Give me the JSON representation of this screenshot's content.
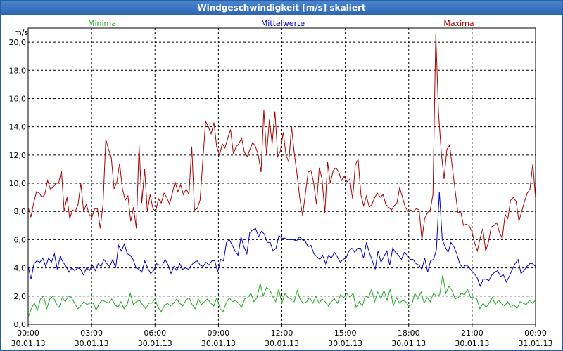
{
  "window": {
    "title": "Windgeschwindigkeit [m/s] skaliert"
  },
  "chart_data": {
    "type": "line",
    "title": "Windgeschwindigkeit [m/s] skaliert",
    "ylabel": "m/s",
    "ylim": [
      0,
      21
    ],
    "y_ticks": [
      "0,0",
      "2,0",
      "4,0",
      "6,0",
      "8,0",
      "10,0",
      "12,0",
      "14,0",
      "16,0",
      "18,0",
      "20,0"
    ],
    "x_start": "30.01.13 00:00",
    "x_end": "31.01.13 00:00",
    "x_ticks": [
      {
        "time": "00:00",
        "date": "30.01.13"
      },
      {
        "time": "03:00",
        "date": "30.01.13"
      },
      {
        "time": "06:00",
        "date": "30.01.13"
      },
      {
        "time": "09:00",
        "date": "30.01.13"
      },
      {
        "time": "12:00",
        "date": "30.01.13"
      },
      {
        "time": "15:00",
        "date": "30.01.13"
      },
      {
        "time": "18:00",
        "date": "30.01.13"
      },
      {
        "time": "21:00",
        "date": "30.01.13"
      },
      {
        "time": "00:00",
        "date": "31.01.13"
      }
    ],
    "grid": true,
    "series": [
      {
        "name": "Minima",
        "color": "#22aa22",
        "values": [
          0.5,
          1.1,
          1.5,
          1.0,
          1.8,
          2.0,
          1.1,
          1.8,
          2.0,
          1.5,
          1.2,
          1.9,
          1.6,
          2.0,
          1.9,
          1.5,
          1.1,
          1.3,
          1.6,
          1.4,
          1.5,
          1.5,
          1.0,
          1.5,
          1.7,
          1.6,
          1.5,
          1.8,
          1.4,
          1.2,
          1.6,
          1.1,
          1.4,
          2.2,
          1.4,
          1.6,
          1.7,
          1.4,
          1.1,
          1.5,
          1.5,
          1.8,
          1.2,
          0.9,
          1.3,
          1.5,
          1.3,
          1.5,
          1.8,
          1.5,
          1.3,
          1.7,
          1.9,
          1.4,
          1.1,
          1.8,
          1.4,
          1.6,
          1.8,
          1.5,
          1.3,
          1.9,
          1.1,
          0.9,
          1.5,
          1.9,
          1.6,
          1.7,
          1.5,
          1.2,
          1.8,
          1.9,
          2.2,
          1.6,
          1.9,
          2.9,
          2.0,
          2.6,
          2.5,
          2.0,
          1.6,
          2.5,
          1.5,
          2.2,
          1.9,
          1.8,
          1.6,
          2.4,
          1.7,
          1.5,
          1.6,
          1.9,
          1.5,
          2.0,
          1.5,
          1.8,
          1.6,
          1.3,
          1.6,
          1.8,
          1.5,
          2.1,
          1.9,
          2.2,
          1.9,
          2.2,
          1.2,
          1.6,
          1.3,
          2.0,
          1.9,
          2.5,
          1.6,
          2.3,
          1.8,
          2.4,
          1.7,
          2.5,
          1.3,
          1.9,
          1.5,
          1.7,
          1.6,
          1.3,
          1.4,
          2.2,
          1.8,
          2.3,
          1.5,
          1.9,
          1.6,
          2.2,
          2.0,
          2.1,
          3.5,
          2.2,
          2.7,
          2.4,
          1.8,
          1.9,
          2.2,
          2.1,
          2.5,
          1.9,
          1.9,
          1.8,
          1.1,
          1.5,
          1.2,
          1.5,
          1.9,
          1.4,
          1.7,
          1.5,
          1.3,
          1.6,
          1.2,
          1.4,
          1.1,
          1.6,
          1.5,
          1.4,
          1.7,
          1.5,
          1.7
        ]
      },
      {
        "name": "Mittelwerte",
        "color": "#0000c0",
        "values": [
          4.1,
          3.2,
          4.3,
          4.5,
          4.4,
          4.7,
          4.1,
          4.7,
          4.4,
          5.0,
          3.9,
          4.8,
          4.4,
          4.1,
          3.7,
          4.0,
          3.8,
          4.0,
          3.9,
          3.5,
          4.0,
          3.8,
          4.2,
          3.8,
          4.3,
          4.1,
          4.6,
          4.3,
          4.1,
          4.6,
          4.0,
          5.6,
          5.2,
          5.7,
          5.0,
          4.9,
          4.6,
          4.0,
          3.9,
          3.7,
          4.5,
          4.0,
          3.6,
          3.8,
          4.3,
          4.2,
          4.2,
          4.6,
          4.2,
          3.6,
          4.1,
          3.8,
          4.3,
          3.9,
          4.0,
          3.9,
          4.2,
          4.4,
          4.5,
          4.2,
          4.1,
          4.4,
          4.2,
          4.5,
          4.5,
          3.7,
          4.6,
          4.5,
          5.8,
          6.0,
          5.6,
          5.2,
          4.9,
          6.2,
          5.5,
          5.0,
          6.5,
          6.7,
          6.8,
          6.2,
          6.6,
          6.4,
          5.8,
          5.8,
          5.2,
          5.4,
          6.3,
          6.1,
          6.1,
          6.0,
          6.0,
          6.0,
          5.9,
          6.2,
          6.0,
          5.9,
          5.5,
          5.6,
          5.0,
          4.8,
          4.6,
          4.9,
          4.3,
          4.9,
          4.7,
          5.1,
          4.8,
          4.4,
          4.6,
          4.7,
          5.2,
          5.4,
          5.1,
          5.4,
          5.4,
          4.7,
          5.8,
          5.1,
          4.5,
          3.9,
          5.2,
          4.4,
          4.8,
          5.2,
          4.2,
          5.4,
          5.1,
          4.9,
          4.6,
          5.1,
          4.9,
          4.6,
          4.6,
          4.3,
          4.2,
          3.9,
          4.7,
          3.7,
          4.5,
          4.6,
          5.3,
          9.4,
          6.0,
          5.5,
          5.1,
          5.8,
          5.5,
          5.0,
          4.3,
          4.0,
          4.2,
          4.1,
          3.8,
          3.6,
          3.3,
          2.7,
          3.2,
          3.2,
          3.1,
          3.5,
          3.7,
          3.8,
          3.4,
          3.5,
          3.0,
          3.4,
          3.9,
          4.3,
          4.6,
          3.6,
          3.8,
          4.1,
          4.3,
          4.3,
          4.1
        ]
      },
      {
        "name": "Maxima",
        "color": "#aa0000",
        "values": [
          8.3,
          7.6,
          8.6,
          9.4,
          9.3,
          9.0,
          9.2,
          10.2,
          9.6,
          9.7,
          10.0,
          10.0,
          10.9,
          8.0,
          9.0,
          7.5,
          8.1,
          8.0,
          8.5,
          10.0,
          8.0,
          8.5,
          7.8,
          7.6,
          8.2,
          8.2,
          6.8,
          8.5,
          13.1,
          12.4,
          11.8,
          9.6,
          10.1,
          11.4,
          9.6,
          8.8,
          9.1,
          7.3,
          8.3,
          6.8,
          12.7,
          8.6,
          11.0,
          8.0,
          9.2,
          8.2,
          8.0,
          8.9,
          8.6,
          9.3,
          9.0,
          8.5,
          9.3,
          10.1,
          9.4,
          9.9,
          9.2,
          9.6,
          9.2,
          12.6,
          8.1,
          8.2,
          8.8,
          11.6,
          14.4,
          14.0,
          13.5,
          14.3,
          12.6,
          12.0,
          12.8,
          12.5,
          13.2,
          13.8,
          12.1,
          12.6,
          12.8,
          13.2,
          12.2,
          11.9,
          12.4,
          12.9,
          12.6,
          12.0,
          10.8,
          15.2,
          12.0,
          14.5,
          12.8,
          15.1,
          11.9,
          12.3,
          13.6,
          12.0,
          11.5,
          14.0,
          12.1,
          10.6,
          8.9,
          7.7,
          9.3,
          10.8,
          10.9,
          10.0,
          8.5,
          11.1,
          10.3,
          7.9,
          11.5,
          10.0,
          10.9,
          11.1,
          10.8,
          10.2,
          10.5,
          10.1,
          10.3,
          8.9,
          11.3,
          11.7,
          9.2,
          8.4,
          9.1,
          8.3,
          8.5,
          9.0,
          9.3,
          9.0,
          9.2,
          8.5,
          8.3,
          8.1,
          8.4,
          8.6,
          9.7,
          9.0,
          8.3,
          8.0,
          8.1,
          8.0,
          8.2,
          8.1,
          6.0,
          7.5,
          7.9,
          8.1,
          9.2,
          20.6,
          15.0,
          12.2,
          10.3,
          12.4,
          12.7,
          11.1,
          9.5,
          7.9,
          8.0,
          7.0,
          7.1,
          7.0,
          6.6,
          5.8,
          5.2,
          6.1,
          6.8,
          5.2,
          5.8,
          6.9,
          7.0,
          7.2,
          6.5,
          6.1,
          7.8,
          7.5,
          8.8,
          9.0,
          8.7,
          7.3,
          8.0,
          8.7,
          9.3,
          9.6,
          11.4,
          8.9
        ]
      }
    ]
  }
}
